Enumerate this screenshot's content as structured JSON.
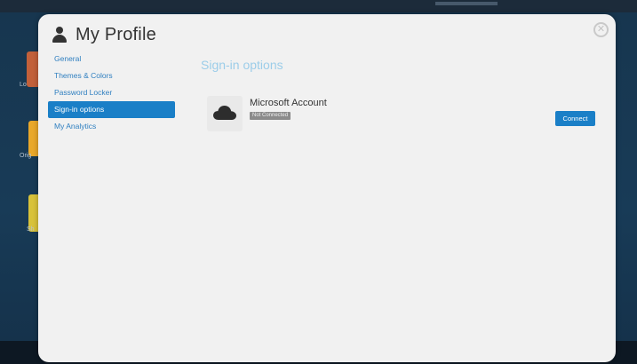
{
  "background": {
    "tile_labels": [
      "Lo",
      "Orig",
      "Sh"
    ]
  },
  "modal": {
    "title": "My Profile",
    "title_icon": "user-icon",
    "close_glyph": "✕"
  },
  "sidebar": {
    "items": [
      {
        "label": "General",
        "active": false
      },
      {
        "label": "Themes & Colors",
        "active": false
      },
      {
        "label": "Password Locker",
        "active": false
      },
      {
        "label": "Sign-in options",
        "active": true
      },
      {
        "label": "My Analytics",
        "active": false
      }
    ]
  },
  "content": {
    "section_title": "Sign-in options",
    "account": {
      "icon": "cloud-icon",
      "name": "Microsoft Account",
      "status": "Not Connected",
      "action_label": "Connect"
    }
  },
  "colors": {
    "accent": "#1a7fc7",
    "section_title": "#9ccde9",
    "modal_bg": "#f1f1f1",
    "badge_bg": "#8b8b8b"
  }
}
